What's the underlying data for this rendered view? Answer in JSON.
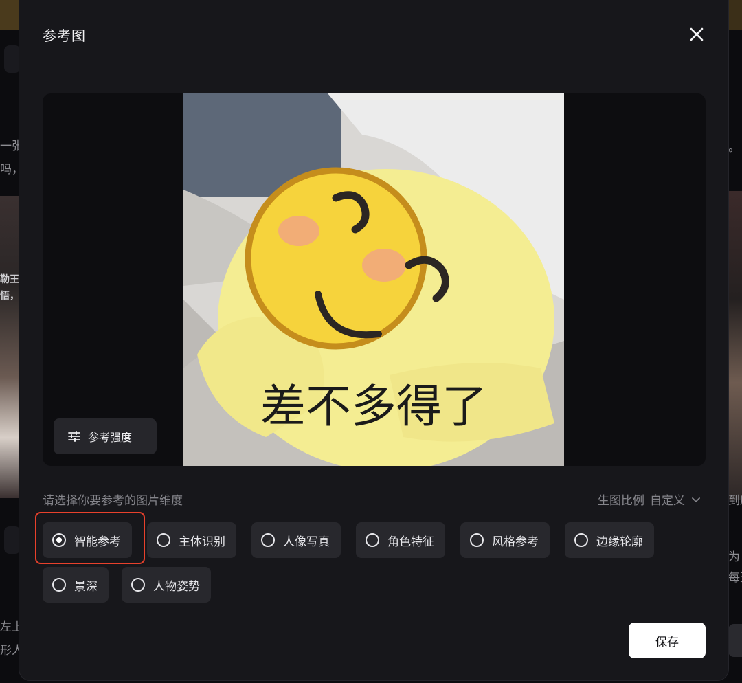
{
  "background": {
    "fragments": {
      "a": "一张",
      "b": "吗，",
      "c": "勒王",
      "d": "悟，",
      "e": "左上",
      "f": "形人",
      "g": "为",
      "h": "每天",
      "i": "到底",
      "j": "。"
    }
  },
  "modal": {
    "title": "参考图",
    "close_icon": "close-icon",
    "image": {
      "caption": "差不多得了"
    },
    "strength_button": {
      "label": "参考强度",
      "icon": "sliders-icon"
    },
    "prompt": "请选择你要参考的图片维度",
    "ratio": {
      "label": "生图比例",
      "value": "自定义",
      "icon": "chevron-down-icon"
    },
    "options": [
      {
        "label": "智能参考",
        "selected": true
      },
      {
        "label": "主体识别",
        "selected": false
      },
      {
        "label": "人像写真",
        "selected": false
      },
      {
        "label": "角色特征",
        "selected": false
      },
      {
        "label": "风格参考",
        "selected": false
      },
      {
        "label": "边缘轮廓",
        "selected": false
      },
      {
        "label": "景深",
        "selected": false
      },
      {
        "label": "人物姿势",
        "selected": false
      }
    ],
    "save_label": "保存"
  },
  "colors": {
    "modal_bg": "#17171b",
    "chip_bg": "#28282d",
    "highlight": "#e8412c",
    "primary_button": "#ffffff"
  }
}
